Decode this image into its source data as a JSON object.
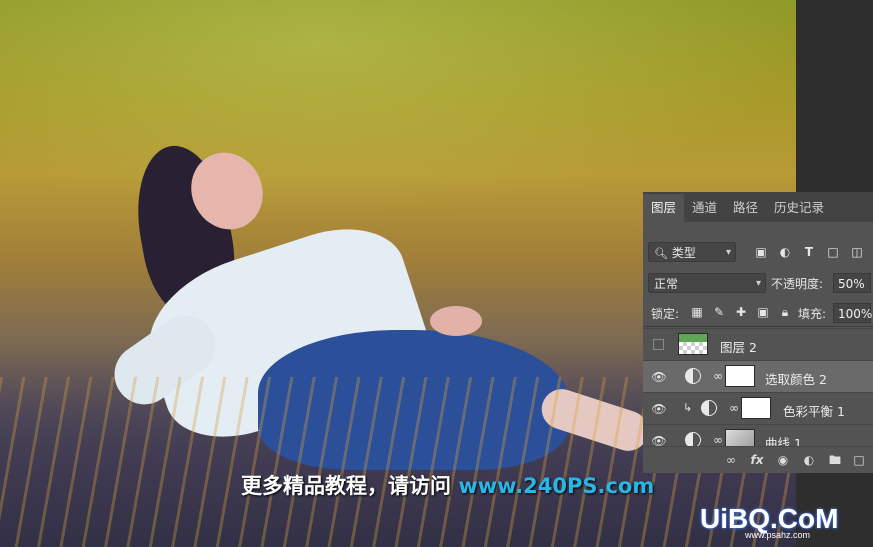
{
  "panel": {
    "tabs": [
      "图层",
      "通道",
      "路径",
      "历史记录"
    ],
    "filter": {
      "label": "类型",
      "icons": [
        "image-filter-icon",
        "adjustment-filter-icon",
        "type-filter-icon",
        "shape-filter-icon",
        "smart-object-filter-icon"
      ]
    },
    "blend_mode": "正常",
    "opacity_label": "不透明度:",
    "opacity_value": "50%",
    "lock_label": "锁定:",
    "fill_label": "填充:",
    "fill_value": "100%",
    "layers": [
      {
        "name": "图层 2",
        "visible": false,
        "selected": false
      },
      {
        "name": "选取颜色 2",
        "visible": true,
        "selected": true
      },
      {
        "name": "色彩平衡 1",
        "visible": true,
        "selected": false,
        "clipped": true
      },
      {
        "name": "曲线 1",
        "visible": true,
        "selected": false
      }
    ],
    "bottom_icons": [
      "link-icon",
      "fx-icon",
      "mask-icon",
      "adjustment-icon",
      "group-icon",
      "new-layer-icon",
      "trash-icon"
    ]
  },
  "overlay": {
    "promo_text": "更多精品教程，请访问",
    "promo_url": "www.240PS.com"
  },
  "watermark": {
    "logo": "UiBQ.CoM",
    "sub": "www.psahz.com"
  },
  "colors": {
    "panel_bg": "#535353",
    "selected_row": "#6a6a6a",
    "url_color": "#29b6e6"
  }
}
